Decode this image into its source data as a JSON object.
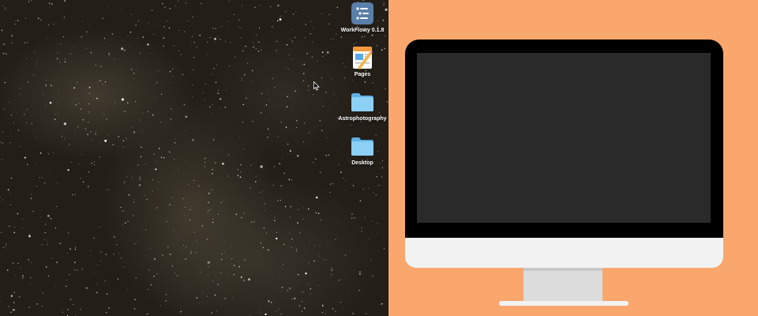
{
  "desktop": {
    "icons": [
      {
        "label": "WorkFlowy 0.1.8",
        "icon": "workflowy-app-icon"
      },
      {
        "label": "Pages",
        "icon": "pages-app-icon"
      },
      {
        "label": "Astrophotography",
        "icon": "folder-icon"
      },
      {
        "label": "Desktop",
        "icon": "folder-icon"
      }
    ]
  },
  "colors": {
    "right_panel_bg": "#f9a76d",
    "imac_bezel": "#000000",
    "imac_screen": "#2a2a2a",
    "imac_chin": "#f2f2f2",
    "folder_blue": "#7fc4ef",
    "workflowy_blue": "#5a7fa8"
  }
}
